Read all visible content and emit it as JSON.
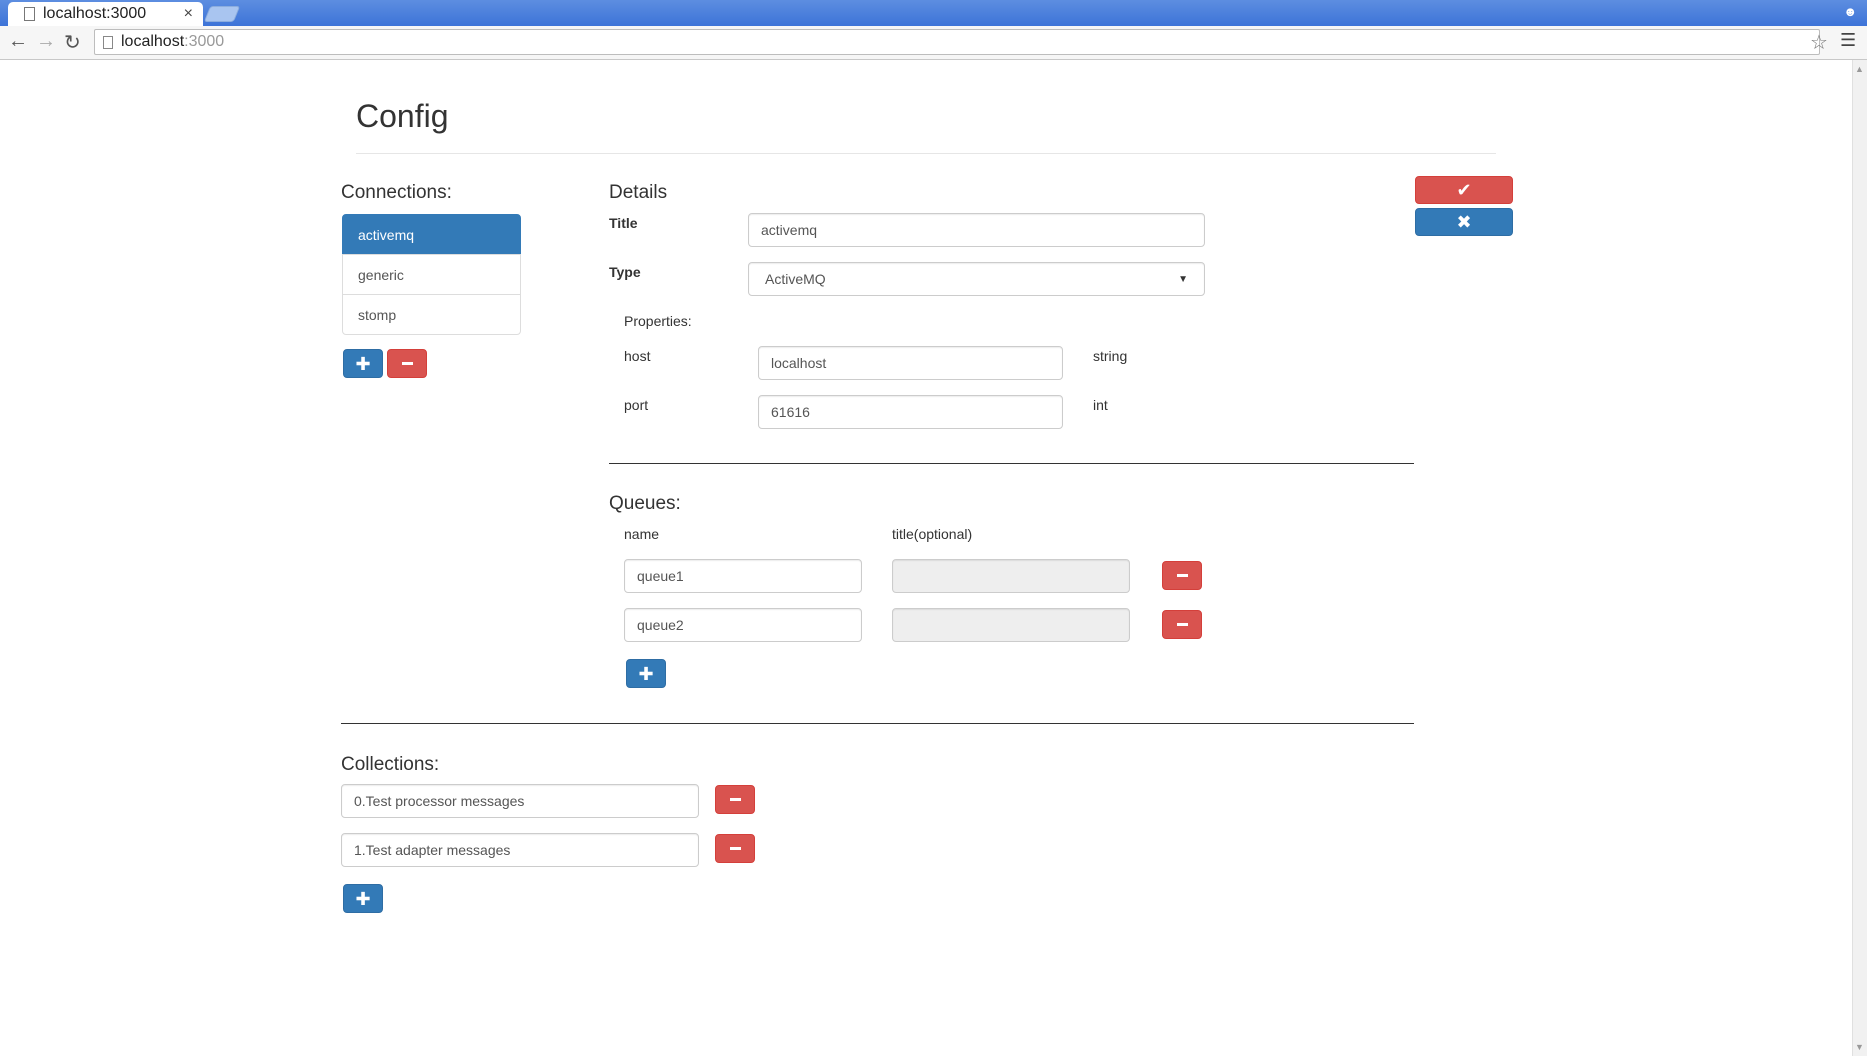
{
  "browser": {
    "tab_title": "localhost:3000",
    "tab_close": "×",
    "url_host": "localhost",
    "url_port": ":3000"
  },
  "page": {
    "title": "Config"
  },
  "connections": {
    "heading": "Connections:",
    "items": [
      {
        "label": "activemq",
        "active": true
      },
      {
        "label": "generic",
        "active": false
      },
      {
        "label": "stomp",
        "active": false
      }
    ],
    "add_icon": "plus-icon",
    "remove_icon": "minus-icon"
  },
  "details": {
    "heading": "Details",
    "title_label": "Title",
    "title_value": "activemq",
    "type_label": "Type",
    "type_value": "ActiveMQ",
    "properties_label": "Properties:",
    "properties": [
      {
        "name": "host",
        "value": "localhost",
        "type": "string"
      },
      {
        "name": "port",
        "value": "61616",
        "type": "int"
      }
    ]
  },
  "actions": {
    "confirm_icon": "check-icon",
    "cancel_icon": "close-icon"
  },
  "queues": {
    "heading": "Queues:",
    "name_header": "name",
    "title_header": "title(optional)",
    "items": [
      {
        "name": "queue1",
        "title": ""
      },
      {
        "name": "queue2",
        "title": ""
      }
    ]
  },
  "collections": {
    "heading": "Collections:",
    "items": [
      {
        "value": "0.Test processor messages"
      },
      {
        "value": "1.Test adapter messages"
      }
    ]
  },
  "colors": {
    "primary": "#337ab7",
    "danger": "#d9534f",
    "tabbar": "#3d74d8"
  }
}
